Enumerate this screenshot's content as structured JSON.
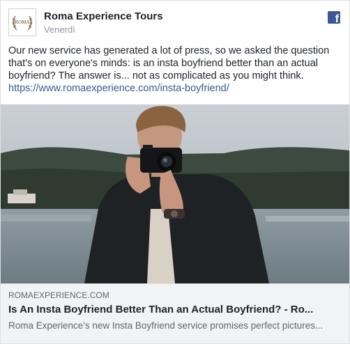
{
  "post": {
    "page_name": "Roma Experience Tours",
    "date": "Venerdì",
    "avatar_text": "ROMA",
    "text": "Our new service has generated a lot of press, so we asked the question that's on everyone's minds: is an insta boyfriend better than an actual boyfriend? The answer is... not as complicated as you might think.",
    "link_url": "https://www.romaexperience.com/insta-boyfriend/"
  },
  "link_preview": {
    "domain": "ROMAEXPERIENCE.COM",
    "title": "Is An Insta Boyfriend Better Than an Actual Boyfriend? - Ro...",
    "description": "Roma Experience's new Insta Boyfriend service promises perfect pictures..."
  },
  "icons": {
    "platform": "facebook-icon",
    "photo": "man-with-camera-photo"
  },
  "colors": {
    "link": "#365899",
    "facebook_blue": "#3b5998",
    "meta_background": "#f2f3f5"
  }
}
